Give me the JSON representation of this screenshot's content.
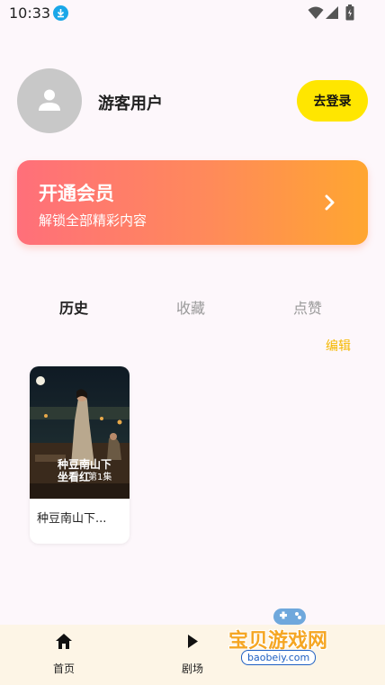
{
  "status_bar": {
    "time": "10:33",
    "icons": [
      "download-icon",
      "wifi-icon",
      "signal-icon",
      "battery-icon"
    ]
  },
  "profile": {
    "avatar_icon": "user-icon",
    "username": "游客用户",
    "login_button": "去登录"
  },
  "vip": {
    "title": "开通会员",
    "subtitle": "解锁全部精彩内容",
    "icon": "chevron-right-icon"
  },
  "tabs": [
    {
      "label": "历史",
      "active": true
    },
    {
      "label": "收藏",
      "active": false
    },
    {
      "label": "点赞",
      "active": false
    }
  ],
  "edit_label": "编辑",
  "history": [
    {
      "title": "种豆南山下...",
      "cover_logo_line1": "种豆南山下",
      "cover_logo_line2": "坐看红",
      "cover_episode": "第1集"
    }
  ],
  "bottom_nav": [
    {
      "label": "首页",
      "icon": "home-icon"
    },
    {
      "label": "剧场",
      "icon": "play-icon"
    }
  ],
  "watermark": {
    "text": "宝贝游戏网",
    "url": "baobeiy.com"
  },
  "colors": {
    "accent_yellow": "#ffe600",
    "vip_gradient_start": "#ff6f7a",
    "vip_gradient_end": "#ffa630",
    "edit_color": "#f5b800",
    "background": "#fdf7fb",
    "nav_background": "#fdf5e6"
  }
}
